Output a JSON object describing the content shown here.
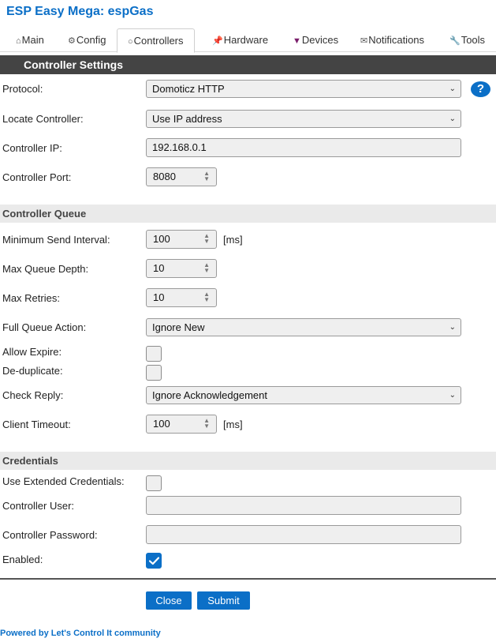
{
  "app": {
    "title": "ESP Easy Mega: espGas"
  },
  "tabs": [
    {
      "icon": "⌂",
      "label": "Main"
    },
    {
      "icon": "⚙",
      "label": "Config"
    },
    {
      "icon": "○",
      "label": "Controllers"
    },
    {
      "icon": "📌",
      "label": "Hardware"
    },
    {
      "icon": "▼",
      "label": "Devices"
    },
    {
      "icon": "✉",
      "label": "Notifications"
    },
    {
      "icon": "🔧",
      "label": "Tools"
    }
  ],
  "settings": {
    "header": "Controller Settings",
    "protocol_label": "Protocol:",
    "protocol_value": "Domoticz HTTP",
    "help_symbol": "?",
    "locate_label": "Locate Controller:",
    "locate_value": "Use IP address",
    "ip_label": "Controller IP:",
    "ip_value": "192.168.0.1",
    "port_label": "Controller Port:",
    "port_value": "8080"
  },
  "queue": {
    "header": "Controller Queue",
    "min_send_label": "Minimum Send Interval:",
    "min_send_value": "100",
    "min_send_unit": "[ms]",
    "max_depth_label": "Max Queue Depth:",
    "max_depth_value": "10",
    "max_retries_label": "Max Retries:",
    "max_retries_value": "10",
    "full_action_label": "Full Queue Action:",
    "full_action_value": "Ignore New",
    "allow_expire_label": "Allow Expire:",
    "allow_expire_checked": false,
    "dedup_label": "De-duplicate:",
    "dedup_checked": false,
    "check_reply_label": "Check Reply:",
    "check_reply_value": "Ignore Acknowledgement",
    "timeout_label": "Client Timeout:",
    "timeout_value": "100",
    "timeout_unit": "[ms]"
  },
  "credentials": {
    "header": "Credentials",
    "extended_label": "Use Extended Credentials:",
    "extended_checked": false,
    "user_label": "Controller User:",
    "user_value": "",
    "password_label": "Controller Password:",
    "password_value": "",
    "enabled_label": "Enabled:",
    "enabled_checked": true
  },
  "actions": {
    "close_label": "Close",
    "submit_label": "Submit"
  },
  "footer": {
    "text": "Powered by Let's Control It community"
  },
  "colors": {
    "accent": "#0b6fc7",
    "header_bg": "#444444",
    "group_bg": "#eaeaea"
  }
}
